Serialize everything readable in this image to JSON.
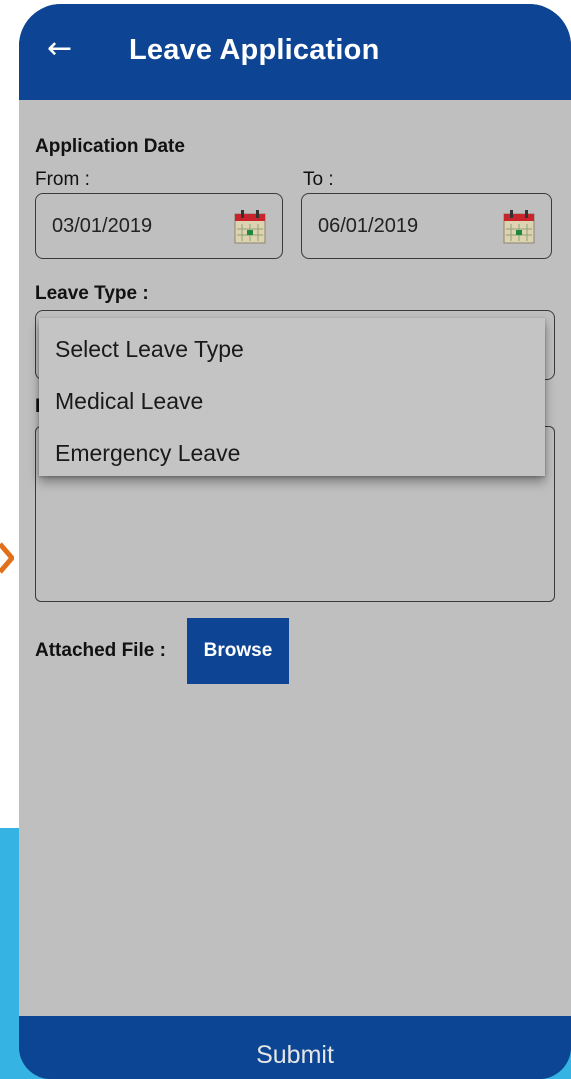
{
  "header": {
    "title": "Leave Application",
    "back_icon": "back-arrow-icon"
  },
  "application_date": {
    "label": "Application Date",
    "from_label": "From :",
    "to_label": "To :",
    "from_value": "03/01/2019",
    "to_value": "06/01/2019",
    "calendar_icon": "calendar-icon"
  },
  "leave_type": {
    "label": "Leave Type :",
    "options": [
      "Select Leave Type",
      "Medical Leave",
      "Emergency Leave"
    ]
  },
  "attachment": {
    "label": "Attached File :",
    "browse_label": "Browse"
  },
  "footer": {
    "submit_label": "Submit"
  },
  "colors": {
    "primary": "#0c4594",
    "overlay_gray": "#bfbfbf",
    "background_accent": "#35b4e3",
    "arrow_accent": "#e2701a"
  }
}
